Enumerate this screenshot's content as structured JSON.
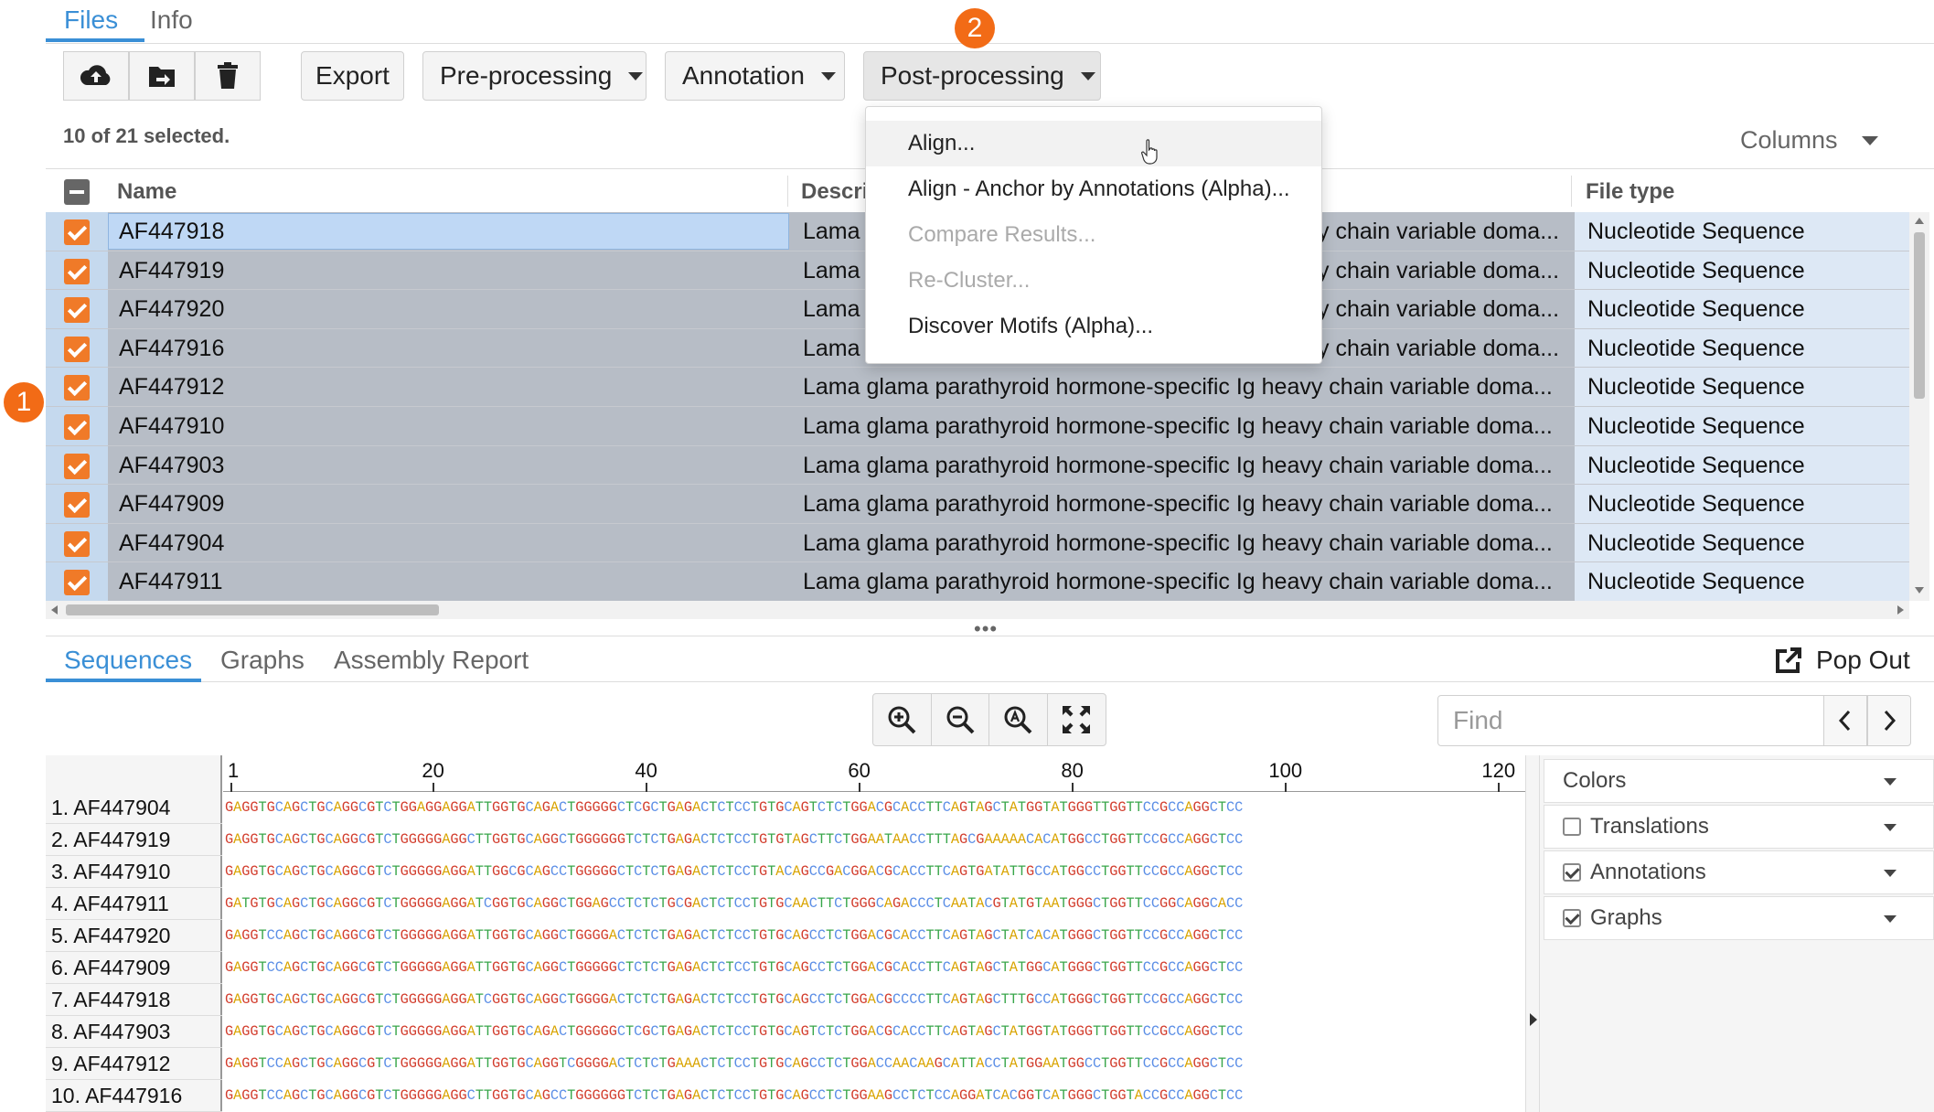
{
  "top_tabs": {
    "files": "Files",
    "info": "Info"
  },
  "toolbar": {
    "upload_icon": "cloud-upload-icon",
    "move_icon": "folder-move-icon",
    "delete_icon": "trash-icon",
    "export": "Export",
    "preprocessing": "Pre-processing",
    "annotation": "Annotation",
    "postprocessing": "Post-processing"
  },
  "badges": {
    "one": "1",
    "two": "2"
  },
  "selection_status": "10 of 21 selected.",
  "columns_label": "Columns",
  "table": {
    "headers": {
      "name": "Name",
      "description": "Descri",
      "file_type": "File type"
    },
    "rows": [
      {
        "name": "AF447918",
        "desc_left": "Lama",
        "desc_right": "y chain variable doma...",
        "type": "Nucleotide Sequence"
      },
      {
        "name": "AF447919",
        "desc_left": "Lama",
        "desc_right": "y chain variable doma...",
        "type": "Nucleotide Sequence"
      },
      {
        "name": "AF447920",
        "desc_left": "Lama",
        "desc_right": "y chain variable doma...",
        "type": "Nucleotide Sequence"
      },
      {
        "name": "AF447916",
        "desc_left": "Lama",
        "desc_right": "y chain variable doma...",
        "type": "Nucleotide Sequence"
      },
      {
        "name": "AF447912",
        "desc": "Lama glama parathyroid hormone-specific Ig heavy chain variable doma...",
        "type": "Nucleotide Sequence"
      },
      {
        "name": "AF447910",
        "desc": "Lama glama parathyroid hormone-specific Ig heavy chain variable doma...",
        "type": "Nucleotide Sequence"
      },
      {
        "name": "AF447903",
        "desc": "Lama glama parathyroid hormone-specific Ig heavy chain variable doma...",
        "type": "Nucleotide Sequence"
      },
      {
        "name": "AF447909",
        "desc": "Lama glama parathyroid hormone-specific Ig heavy chain variable doma...",
        "type": "Nucleotide Sequence"
      },
      {
        "name": "AF447904",
        "desc": "Lama glama parathyroid hormone-specific Ig heavy chain variable doma...",
        "type": "Nucleotide Sequence"
      },
      {
        "name": "AF447911",
        "desc": "Lama glama parathyroid hormone-specific Ig heavy chain variable doma...",
        "type": "Nucleotide Sequence"
      }
    ]
  },
  "menu": {
    "align": "Align...",
    "align_anchor": "Align - Anchor by Annotations (Alpha)...",
    "compare": "Compare Results...",
    "recluster": "Re-Cluster...",
    "discover": "Discover Motifs (Alpha)..."
  },
  "bottom_tabs": {
    "sequences": "Sequences",
    "graphs": "Graphs",
    "assembly": "Assembly Report",
    "popout": "Pop Out"
  },
  "zoom": {
    "zoom_in": "zoom-in-icon",
    "zoom_out": "zoom-out-icon",
    "zoom_reset": "zoom-reset-icon",
    "fit": "fit-screen-icon"
  },
  "find": {
    "placeholder": "Find"
  },
  "ruler": [
    "1",
    "20",
    "40",
    "60",
    "80",
    "100",
    "120"
  ],
  "sequences": [
    {
      "label": "1. AF447904",
      "seq": "GAGGTGCAGCTGCAGGCGTCTGGAGGAGGATTGGTGCAGACTGGGGGCTCGCTGAGACTCTCCTGTGCAGTCTCTGGACGCACCTTCAGTAGCTATGGTATGGGTTGGTTCCGCCAGGCTCC"
    },
    {
      "label": "2. AF447919",
      "seq": "GAGGTGCAGCTGCAGGCGTCTGGGGGAGGCTTGGTGCAGGCTGGGGGGTCTCTGAGACTCTCCTGTGTAGCTTCTGGAATAACCTTTAGCGAAAAACACATGGCCTGGTTCCGCCAGGCTCC"
    },
    {
      "label": "3. AF447910",
      "seq": "GAGGTGCAGCTGCAGGCGTCTGGGGGAGGATTGGCGCAGCCTGGGGGCTCTCTGAGACTCTCCTGTACAGCCGACGGACGCACCTTCAGTGATATTGCCATGGCCTGGTTCCGCCAGGCTCC"
    },
    {
      "label": "4. AF447911",
      "seq": "GATGTGCAGCTGCAGGCGTCTGGGGGAGGATCGGTGCAGGCTGGAGCCTCTCTGCGACTCTCCTGTGCAACTTCTGGGCAGACCCTCAATACGTATGTAATGGGCTGGTTCCGGCAGGCACC"
    },
    {
      "label": "5. AF447920",
      "seq": "GAGGTCCAGCTGCAGGCGTCTGGGGGAGGATTGGTGCAGGCTGGGGACTCTCTGAGACTCTCCTGTGCAGCCTCTGGACGCACCTTCAGTAGCTATCACATGGGCTGGTTCCGCCAGGCTCC"
    },
    {
      "label": "6. AF447909",
      "seq": "GAGGTCCAGCTGCAGGCGTCTGGGGGAGGATTGGTGCAGGCTGGGGGCTCTCTGAGACTCTCCTGTGCAGCCTCTGGACGCACCTTCAGTAGCTATGGCATGGGCTGGTTCCGCCAGGCTCC"
    },
    {
      "label": "7. AF447918",
      "seq": "GAGGTGCAGCTGCAGGCGTCTGGGGGAGGATCGGTGCAGGCTGGGGACTCTCTGAGACTCTCCTGTGCAGCCTCTGGACGCCCCTTCAGTAGCTTTGCCATGGGCTGGTTCCGCCAGGCTCC"
    },
    {
      "label": "8. AF447903",
      "seq": "GAGGTGCAGCTGCAGGCGTCTGGGGGAGGATTGGTGCAGACTGGGGGCTCGCTGAGACTCTCCTGTGCAGTCTCTGGACGCACCTTCAGTAGCTATGGTATGGGTTGGTTCCGCCAGGCTCC"
    },
    {
      "label": "9. AF447912",
      "seq": "GAGGTCCAGCTGCAGGCGTCTGGGGGAGGATTGGTGCAGGTCGGGGACTCTCTGAAACTCTCCTGTGCAGCCTCTGGACCAACAAGCATTACCTATGGAATGGCCTGGTTCCGCCAGGCTCC"
    },
    {
      "label": "10. AF447916",
      "seq": "GAGGTCCAGCTGCAGGCGTCTGGGGGAGGCTTGGTGCAGCCTGGGGGGTCTCTGAGACTCTCCTGTGCAGCCTCTGGAAGCCTCTCCAGGATCACGGTCATGGGCTGGTACCGCCAGGCTCC"
    }
  ],
  "side_panel": {
    "colors": "Colors",
    "translations": "Translations",
    "annotations": "Annotations",
    "graphs": "Graphs"
  },
  "colors": {
    "accent": "#3a8fd6",
    "badge": "#f26b16",
    "checkbox": "#f07a28",
    "row_selected": "#b7bdc6",
    "A": "#d9a400",
    "C": "#5b8ee6",
    "G": "#d23c2c",
    "T": "#38a64a"
  }
}
